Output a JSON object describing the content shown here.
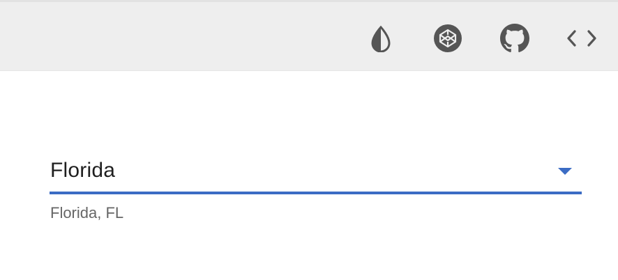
{
  "toolbar": {
    "icons": [
      {
        "name": "theme-toggle-icon",
        "label": "Theme"
      },
      {
        "name": "codepen-icon",
        "label": "CodePen"
      },
      {
        "name": "github-icon",
        "label": "GitHub"
      },
      {
        "name": "code-icon",
        "label": "Source code"
      }
    ],
    "icon_color": "#555555",
    "background": "#eeeeee"
  },
  "select": {
    "value": "Florida",
    "helper_text": "Florida, FL",
    "accent_color": "#3b6cc4"
  }
}
